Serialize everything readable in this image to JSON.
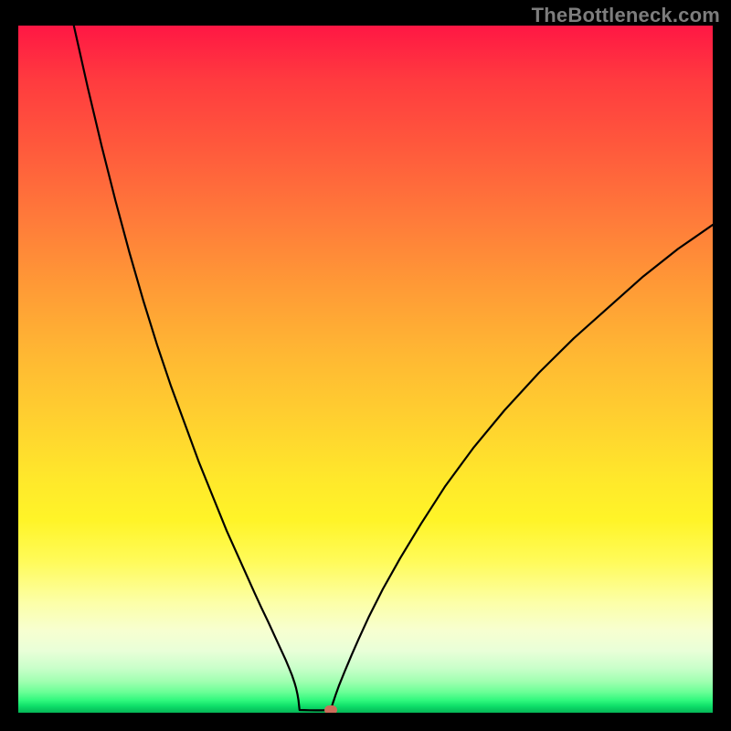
{
  "watermark": "TheBottleneck.com",
  "colors": {
    "frame_border": "#000000",
    "curve": "#000000",
    "marker": "#cc6e5a",
    "gradient_stops": [
      "#ff1744",
      "#ff3b3f",
      "#ff5a3c",
      "#ff7a3a",
      "#ff9a36",
      "#ffb833",
      "#ffd22f",
      "#ffe82b",
      "#fff428",
      "#fffb5a",
      "#fcffa8",
      "#f7ffd0",
      "#e9ffd8",
      "#c9ffca",
      "#9fffb0",
      "#6aff96",
      "#30f87d",
      "#10e06a",
      "#08c75e",
      "#06b556"
    ]
  },
  "chart_data": {
    "type": "line",
    "title": "",
    "xlabel": "",
    "ylabel": "",
    "xlim": [
      0,
      100
    ],
    "ylim": [
      0,
      100
    ],
    "grid": false,
    "legend": false,
    "gradient_meaning": "red=high bottleneck, green=balanced",
    "series": [
      {
        "name": "left-curve",
        "values_xy": [
          [
            6,
            109
          ],
          [
            8,
            100
          ],
          [
            10,
            91
          ],
          [
            12,
            82.5
          ],
          [
            14,
            74.5
          ],
          [
            16,
            67
          ],
          [
            18,
            60
          ],
          [
            20,
            53.5
          ],
          [
            22,
            47.5
          ],
          [
            24,
            42
          ],
          [
            26,
            36.5
          ],
          [
            28,
            31.5
          ],
          [
            30,
            26.5
          ],
          [
            32,
            22
          ],
          [
            34,
            17.5
          ],
          [
            35,
            15.3
          ],
          [
            36,
            13.2
          ],
          [
            37,
            11
          ],
          [
            38,
            8.8
          ],
          [
            38.5,
            7.7
          ],
          [
            39,
            6.5
          ],
          [
            39.4,
            5.5
          ],
          [
            39.8,
            4.3
          ],
          [
            40,
            3.6
          ],
          [
            40.2,
            2.7
          ],
          [
            40.35,
            1.8
          ],
          [
            40.5,
            0.4
          ]
        ]
      },
      {
        "name": "flat-bottom",
        "values_xy": [
          [
            40.5,
            0.4
          ],
          [
            41.2,
            0.38
          ],
          [
            42.0,
            0.36
          ],
          [
            42.8,
            0.35
          ],
          [
            43.6,
            0.35
          ],
          [
            44.3,
            0.37
          ],
          [
            45.0,
            0.4
          ]
        ]
      },
      {
        "name": "right-curve",
        "values_xy": [
          [
            45.0,
            0.4
          ],
          [
            45.3,
            1.4
          ],
          [
            45.7,
            2.6
          ],
          [
            46.2,
            4.0
          ],
          [
            47.0,
            6.0
          ],
          [
            48.0,
            8.4
          ],
          [
            49.0,
            10.7
          ],
          [
            50.5,
            14
          ],
          [
            52.5,
            18
          ],
          [
            55,
            22.5
          ],
          [
            58,
            27.5
          ],
          [
            61.5,
            33
          ],
          [
            65.5,
            38.5
          ],
          [
            70,
            44
          ],
          [
            75,
            49.5
          ],
          [
            80,
            54.5
          ],
          [
            85,
            59
          ],
          [
            90,
            63.5
          ],
          [
            95,
            67.5
          ],
          [
            100,
            71
          ]
        ]
      }
    ],
    "marker": {
      "x": 45.0,
      "y": 0.4
    }
  }
}
